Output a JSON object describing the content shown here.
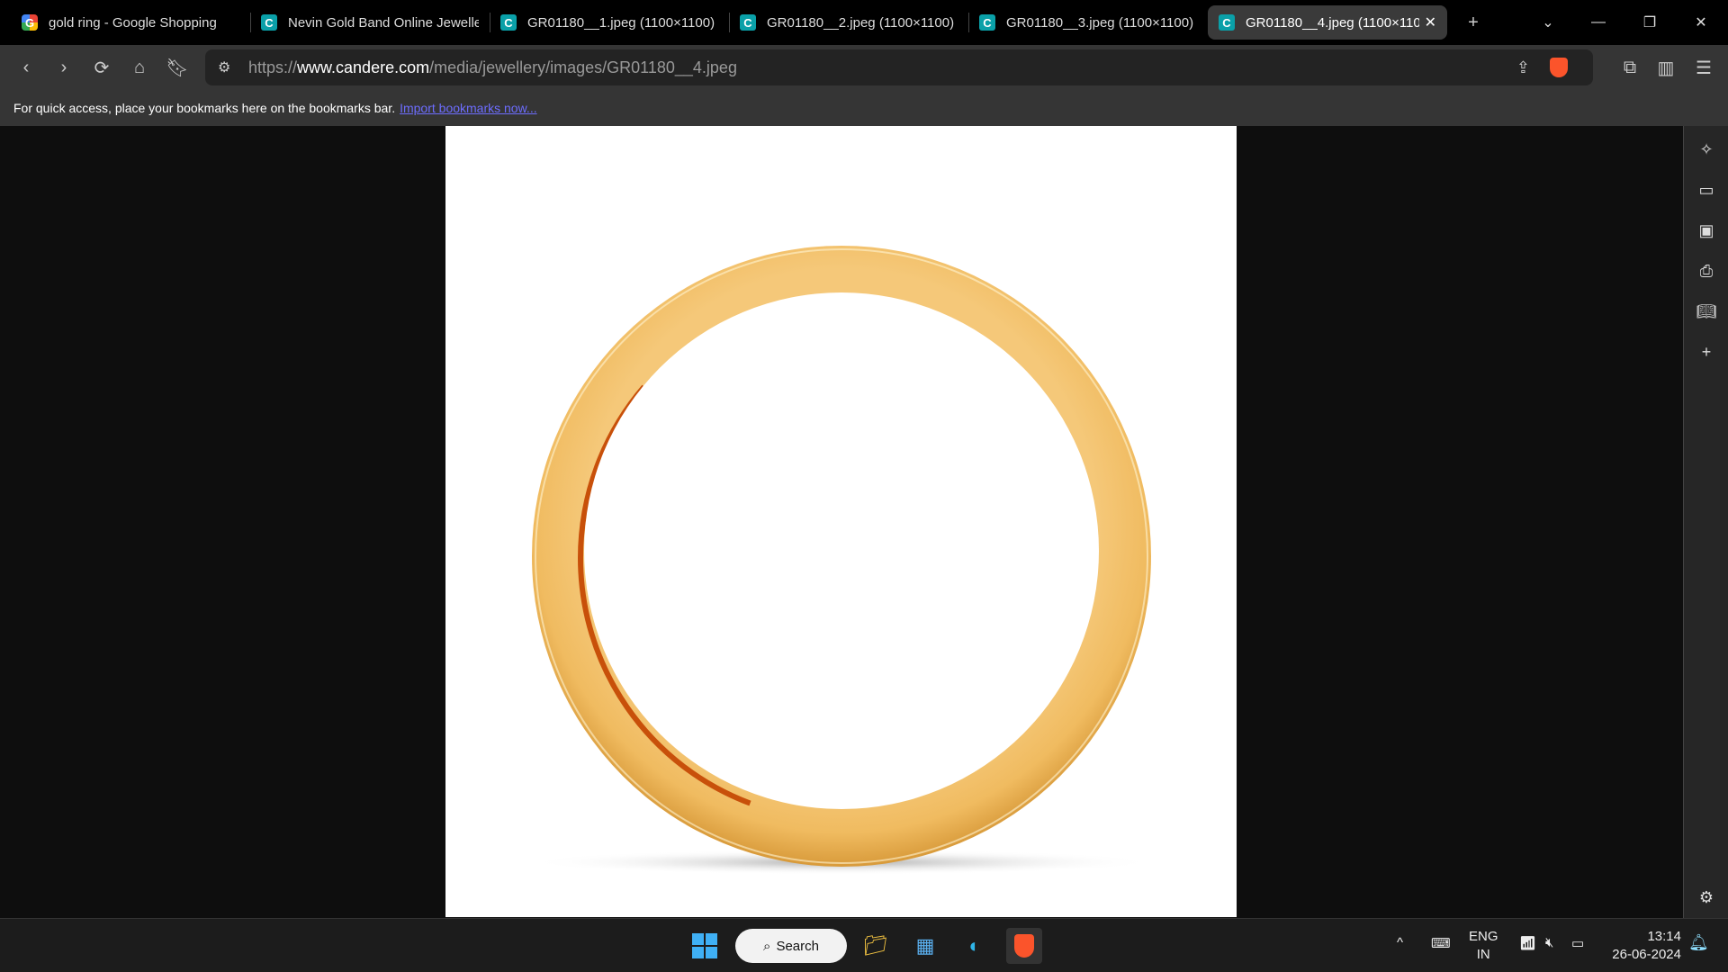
{
  "tabs": [
    {
      "title": "gold ring - Google Shopping",
      "favicon": "google-shopping"
    },
    {
      "title": "Nevin Gold Band Online Jewelle",
      "favicon": "candere"
    },
    {
      "title": "GR01180__1.jpeg (1100×1100)",
      "favicon": "candere"
    },
    {
      "title": "GR01180__2.jpeg (1100×1100)",
      "favicon": "candere"
    },
    {
      "title": "GR01180__3.jpeg (1100×1100)",
      "favicon": "candere"
    },
    {
      "title": "GR01180__4.jpeg (1100×1100)",
      "favicon": "candere",
      "active": true
    }
  ],
  "address": {
    "scheme": "https://",
    "host": "www.candere.com",
    "path": "/media/jewellery/images/GR01180__4.jpeg"
  },
  "bookmarks_bar": {
    "message": "For quick access, place your bookmarks here on the bookmarks bar.",
    "link": "Import bookmarks now..."
  },
  "image": {
    "subject": "gold ring",
    "colors": {
      "gold": "#f2c06a",
      "inner_orange": "#c8500a"
    }
  },
  "taskbar": {
    "search_label": "Search",
    "language": "ENG",
    "region": "IN",
    "time": "13:14",
    "date": "26-06-2024"
  }
}
